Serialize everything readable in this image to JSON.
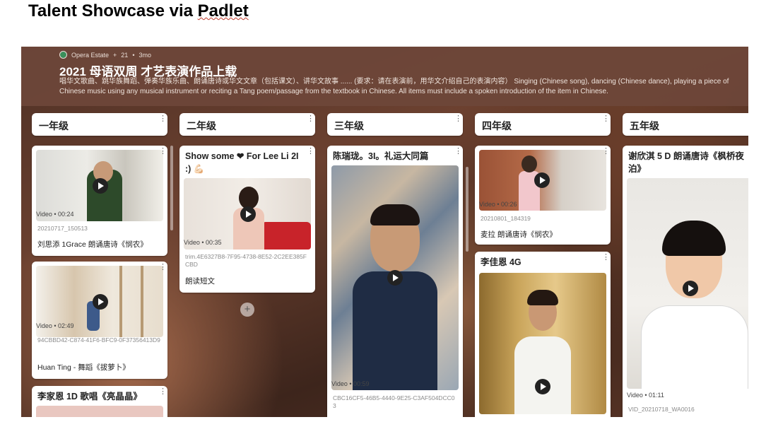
{
  "doc_title_prefix": "Talent Showcase via ",
  "doc_title_suffix": "Padlet",
  "board": {
    "meta_author": "Opera Estate",
    "meta_plus": "21",
    "meta_time": "3mo",
    "title": "2021 母语双周 才艺表演作品上载",
    "description": "唱华文歌曲、跳华族舞蹈、弹奏华族乐曲、朗诵唐诗或华文文章（包括课文）、讲华文故事 ...... (要求：请在表演前，用华文介绍自己的表演内容） Singing (Chinese song), dancing (Chinese dance), playing a piece of Chinese music using any musical instrument or reciting a Tang poem/passage from the textbook in Chinese. All items must include a spoken introduction of the item in Chinese."
  },
  "columns": [
    {
      "title": "一年级"
    },
    {
      "title": "二年级"
    },
    {
      "title": "三年级"
    },
    {
      "title": "四年级"
    },
    {
      "title": "五年级"
    }
  ],
  "cards": {
    "c1a": {
      "video": "Video",
      "duration": "00:24",
      "filename": "20210717_150513",
      "caption": "刘思添 1Grace 朗诵唐诗《悯农》"
    },
    "c1b": {
      "video": "Video",
      "duration": "02:49",
      "filename": "94CBBD42-C874-41F6-BFC9-0F37356413D9",
      "caption": "Huan Ting - 舞蹈《拔萝卜》"
    },
    "c1c": {
      "title": "李家恩 1D 歌唱《亮晶晶》"
    },
    "c2a": {
      "title": "Show some ❤ For Lee Li 2I :) 💪🏻",
      "video": "Video",
      "duration": "00:35",
      "filename": "trim.4E6327B8-7F95-4738-8E52-2C2EE385FCBD",
      "caption": "朗读短文"
    },
    "c3a": {
      "title": "陈瑞珑。3I。礼运大同篇",
      "video": "Video",
      "duration": "00:59",
      "filename": "CBC16CF5-46B5-4440-9E25-C3AF504DCC03"
    },
    "c4a": {
      "video": "Video",
      "duration": "00:26",
      "filename": "20210801_184319",
      "caption": "麦拉 朗诵唐诗《悯农》"
    },
    "c4b": {
      "title": "李佳恩 4G"
    },
    "c5a": {
      "title": "谢欣淇 5 D 朗诵唐诗《枫桥夜泊》",
      "video": "Video",
      "duration": "01:11",
      "filename": "VID_20210718_WA0016"
    }
  },
  "add_symbol": "+",
  "colors": {
    "board_header": "#6e463a",
    "card_bg": "#ffffff",
    "text": "#222222"
  }
}
